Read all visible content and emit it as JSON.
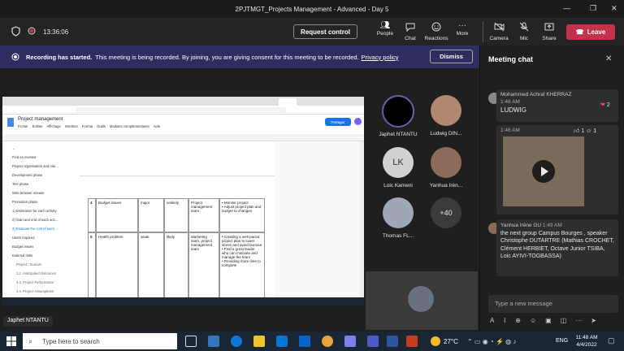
{
  "window": {
    "title": "2PJTMGT_Projects Management - Advanced - Day 5"
  },
  "toolbar": {
    "time": "13:36:06",
    "request_control": "Request control",
    "people": "People",
    "chat": "Chat",
    "reactions": "Reactions",
    "more": "More",
    "camera": "Camera",
    "mic": "Mic",
    "share": "Share",
    "leave": "Leave"
  },
  "banner": {
    "bold": "Recording has started.",
    "text": "This meeting is being recorded. By joining, you are giving consent for this meeting to be recorded.",
    "link": "Privacy policy",
    "dismiss": "Dismiss"
  },
  "participants": [
    {
      "name": "Japhet NTANTU",
      "initials": ""
    },
    {
      "name": "Ludwig DIN...",
      "initials": ""
    },
    {
      "name": "Loic Kameni",
      "initials": "LK"
    },
    {
      "name": "Yanhua Irèn...",
      "initials": ""
    },
    {
      "name": "Thomas FL...",
      "initials": ""
    },
    {
      "name": "",
      "initials": "+40"
    }
  ],
  "presenter": {
    "name": "Japhet NTANTU"
  },
  "doc": {
    "title": "Project management",
    "menu": [
      "Fichier",
      "Édition",
      "Affichage",
      "Insertion",
      "Format",
      "Outils",
      "Modules complémentaires",
      "Aide"
    ],
    "share": "Partager",
    "outline": [
      "Find an investor",
      "Project organization and role...",
      "Development phase",
      "Test phase",
      "Web browser release",
      "Promotion phase",
      "1) Estimation for each activity",
      "2) Start and end of each acti...",
      "3) Estimate the cost of each ...",
      "Users required",
      "Budget issues",
      "External risks",
      "Project : Sunrain",
      "1.2. Anticipated Outcomes",
      "4.3. Project Performance",
      "4.4. Project Assumptions"
    ],
    "rows": [
      {
        "num": "4",
        "risk": "Budget issues",
        "impact": "major",
        "prob": "unlikely",
        "owner": "Project management team",
        "actions": [
          "Monitor project",
          "Adjust project plan and budget to changes"
        ]
      },
      {
        "num": "5",
        "risk": "Health problem",
        "impact": "weak",
        "prob": "likely",
        "owner": "Marketing team, project management team",
        "actions": [
          "Creating a well-paced project plan to lower stress and avoid burnout",
          "Find a great leader who can motivate and manage the team",
          "Providing more time to complete"
        ]
      }
    ]
  },
  "chat": {
    "title": "Meeting chat",
    "messages": [
      {
        "author": "Mohammed Achraf KHERRAZ",
        "time": "1:46 AM",
        "text": "LUDWIG",
        "reaction_count": "2"
      },
      {
        "author": "",
        "time": "1:46 AM",
        "text": "",
        "reaction_count": "1",
        "reaction_count2": "1"
      },
      {
        "author": "Yanhua Irène GU",
        "time": "1:49 AM",
        "text": "the next group Campus Bourges , speaker Christophe DUTARTRE (Mathias CROCHET, Clément HERBIET, Octave Junior TSIBA, Loic AYIVI-TOGBASSA)"
      }
    ],
    "input_placeholder": "Type a new message"
  },
  "taskbar": {
    "search_placeholder": "Type here to search",
    "weather": "27°C",
    "lang": "ENG",
    "clock_time": "11:48 AM",
    "clock_date": "4/4/2022"
  },
  "colors": {
    "leave": "#c4314b",
    "banner": "#2b2e5e",
    "accent": "#6264a7"
  }
}
